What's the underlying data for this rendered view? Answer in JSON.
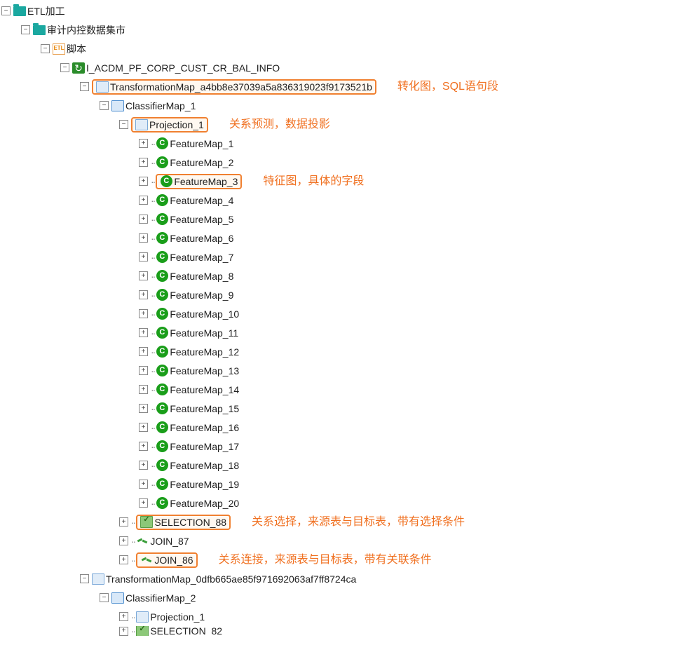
{
  "tree": {
    "root": "ETL加工",
    "datamart": "审计内控数据集市",
    "script": "脚本",
    "etl_label": "ETL",
    "job": "I_ACDM_PF_CORP_CUST_CR_BAL_INFO",
    "tmap1": "TransformationMap_a4bb8e37039a5a836319023f9173521b",
    "cmap1": "ClassifierMap_1",
    "proj1": "Projection_1",
    "features": [
      "FeatureMap_1",
      "FeatureMap_2",
      "FeatureMap_3",
      "FeatureMap_4",
      "FeatureMap_5",
      "FeatureMap_6",
      "FeatureMap_7",
      "FeatureMap_8",
      "FeatureMap_9",
      "FeatureMap_10",
      "FeatureMap_11",
      "FeatureMap_12",
      "FeatureMap_13",
      "FeatureMap_14",
      "FeatureMap_15",
      "FeatureMap_16",
      "FeatureMap_17",
      "FeatureMap_18",
      "FeatureMap_19",
      "FeatureMap_20"
    ],
    "selection88": "SELECTION_88",
    "join87": "JOIN_87",
    "join86": "JOIN_86",
    "tmap2": "TransformationMap_0dfb665ae85f971692063af7ff8724ca",
    "cmap2": "ClassifierMap_2",
    "proj2": "Projection_1",
    "selection82": "SELECTION_82"
  },
  "annotations": {
    "tmap": "转化图，SQL语句段",
    "proj": "关系预测，数据投影",
    "feat": "特征图，具体的字段",
    "sel": "关系选择，来源表与目标表，带有选择条件",
    "join": "关系连接，来源表与目标表，带有关联条件"
  },
  "glyphs": {
    "plus": "+",
    "minus": "−",
    "feat_letter": "C",
    "refresh": "↻"
  }
}
